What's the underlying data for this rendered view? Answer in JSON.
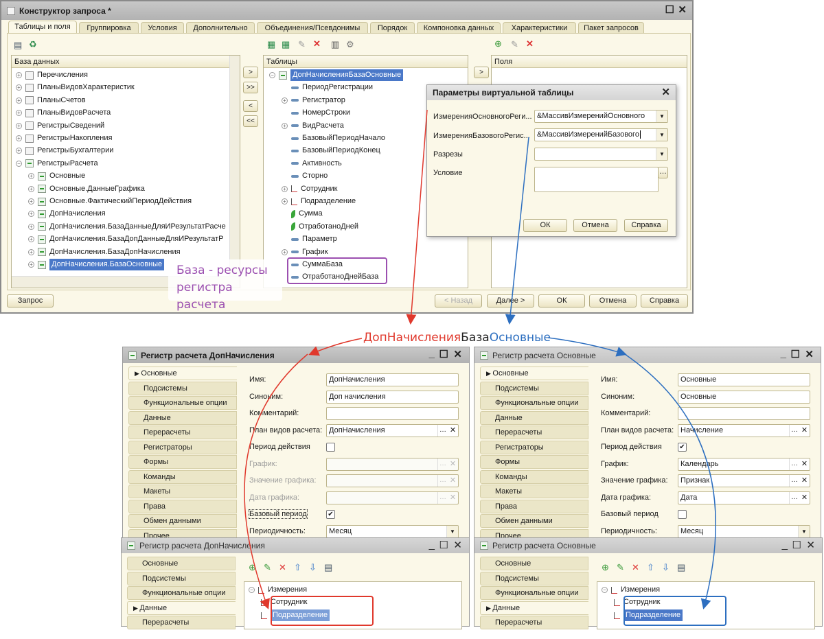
{
  "main_window": {
    "title": "Конструктор запроса *",
    "tabs": [
      "Таблицы и поля",
      "Группировка",
      "Условия",
      "Дополнительно",
      "Объединения/Псевдонимы",
      "Порядок",
      "Компоновка данных",
      "Характеристики",
      "Пакет запросов"
    ],
    "active_tab": "Таблицы и поля",
    "database_panel": {
      "header": "База данных",
      "items": [
        {
          "label": "Перечисления",
          "icon": "enum-icon",
          "level": 0,
          "exp": "+"
        },
        {
          "label": "ПланыВидовХарактеристик",
          "icon": "chart-of-characteristics-icon",
          "level": 0,
          "exp": "+"
        },
        {
          "label": "ПланыСчетов",
          "icon": "chart-of-accounts-icon",
          "level": 0,
          "exp": "+"
        },
        {
          "label": "ПланыВидовРасчета",
          "icon": "chart-of-calculation-types-icon",
          "level": 0,
          "exp": "+"
        },
        {
          "label": "РегистрыСведений",
          "icon": "information-register-icon",
          "level": 0,
          "exp": "+"
        },
        {
          "label": "РегистрыНакопления",
          "icon": "accumulation-register-icon",
          "level": 0,
          "exp": "+"
        },
        {
          "label": "РегистрыБухгалтерии",
          "icon": "accounting-register-icon",
          "level": 0,
          "exp": "+"
        },
        {
          "label": "РегистрыРасчета",
          "icon": "calculation-register-icon",
          "level": 0,
          "exp": "−"
        },
        {
          "label": "Основные",
          "icon": "calculation-register-icon",
          "level": 1,
          "exp": "+"
        },
        {
          "label": "Основные.ДанныеГрафика",
          "icon": "calculation-register-icon",
          "level": 1,
          "exp": "+"
        },
        {
          "label": "Основные.ФактическийПериодДействия",
          "icon": "calculation-register-icon",
          "level": 1,
          "exp": "+"
        },
        {
          "label": "ДопНачисления",
          "icon": "calculation-register-icon",
          "level": 1,
          "exp": "+"
        },
        {
          "label": "ДопНачисления.БазаДанныеДляИРезультатРасче",
          "icon": "calculation-register-icon",
          "level": 1,
          "exp": "+"
        },
        {
          "label": "ДопНачисления.БазаДопДанныеДляИРезультатР",
          "icon": "calculation-register-icon",
          "level": 1,
          "exp": "+"
        },
        {
          "label": "ДопНачисления.БазаДопНачисления",
          "icon": "calculation-register-icon",
          "level": 1,
          "exp": "+"
        },
        {
          "label": "ДопНачисления.БазаОсновные",
          "icon": "calculation-register-icon",
          "level": 1,
          "exp": "+",
          "selected": true
        }
      ]
    },
    "move_buttons": [
      ">",
      ">>",
      "<",
      "<<"
    ],
    "tables_panel": {
      "header": "Таблицы",
      "items": [
        {
          "label": "ДопНачисленияБазаОсновные",
          "icon": "calculation-register-icon",
          "level": 0,
          "exp": "−",
          "selected": true
        },
        {
          "label": "ПериодРегистрации",
          "icon": "attribute-icon",
          "level": 1,
          "exp": ""
        },
        {
          "label": "Регистратор",
          "icon": "attribute-icon",
          "level": 1,
          "exp": "+"
        },
        {
          "label": "НомерСтроки",
          "icon": "attribute-icon",
          "level": 1,
          "exp": ""
        },
        {
          "label": "ВидРасчета",
          "icon": "attribute-icon",
          "level": 1,
          "exp": "+"
        },
        {
          "label": "БазовыйПериодНачало",
          "icon": "attribute-icon",
          "level": 1,
          "exp": ""
        },
        {
          "label": "БазовыйПериодКонец",
          "icon": "attribute-icon",
          "level": 1,
          "exp": ""
        },
        {
          "label": "Активность",
          "icon": "attribute-icon",
          "level": 1,
          "exp": ""
        },
        {
          "label": "Сторно",
          "icon": "attribute-icon",
          "level": 1,
          "exp": ""
        },
        {
          "label": "Сотрудник",
          "icon": "dimension-icon",
          "level": 1,
          "exp": "+"
        },
        {
          "label": "Подразделение",
          "icon": "dimension-icon",
          "level": 1,
          "exp": "+"
        },
        {
          "label": "Сумма",
          "icon": "resource-icon",
          "level": 1,
          "exp": ""
        },
        {
          "label": "ОтработаноДней",
          "icon": "resource-icon",
          "level": 1,
          "exp": ""
        },
        {
          "label": "Параметр",
          "icon": "attribute-icon",
          "level": 1,
          "exp": ""
        },
        {
          "label": "График",
          "icon": "attribute-icon",
          "level": 1,
          "exp": "+"
        },
        {
          "label": "СуммаБаза",
          "icon": "attribute-icon",
          "level": 1,
          "exp": ""
        },
        {
          "label": "ОтработаноДнейБаза",
          "icon": "attribute-icon",
          "level": 1,
          "exp": ""
        }
      ]
    },
    "fields_panel": {
      "header": "Поля",
      "add_button": ">"
    },
    "buttons": {
      "query": "Запрос",
      "back": "< Назад",
      "next": "Далее >",
      "ok": "ОК",
      "cancel": "Отмена",
      "help": "Справка"
    }
  },
  "virtual_params_dialog": {
    "title": "Параметры виртуальной таблицы",
    "fields": [
      {
        "label": "ИзмеренияОсновногоРеги...",
        "value": "&МассивИзмеренийОсновного"
      },
      {
        "label": "ИзмеренияБазовогоРегис...",
        "value": "&МассивИзмеренийБазового"
      },
      {
        "label": "Разрезы",
        "value": ""
      },
      {
        "label": "Условие",
        "value": ""
      }
    ],
    "buttons": {
      "ok": "ОК",
      "cancel": "Отмена",
      "help": "Справка"
    }
  },
  "annotations": {
    "base_note_line1": "База - ресурсы",
    "base_note_line2": "регистра расчета",
    "center_part1": "ДопНачисления",
    "center_part2": "База",
    "center_part3": "Основные",
    "colors": {
      "red": "#e0382c",
      "blue": "#2d6fc0",
      "purple": "#9b4fb0"
    }
  },
  "register_windows": [
    {
      "title": "Регистр расчета ДопНачисления",
      "tabs": [
        "Основные",
        "Подсистемы",
        "Функциональные опции",
        "Данные",
        "Перерасчеты",
        "Регистраторы",
        "Формы",
        "Команды",
        "Макеты",
        "Права",
        "Обмен данными",
        "Прочее"
      ],
      "fields": [
        {
          "label": "Имя:",
          "kind": "text",
          "value": "ДопНачисления"
        },
        {
          "label": "Синоним:",
          "kind": "text",
          "value": "Доп начисления"
        },
        {
          "label": "Комментарий:",
          "kind": "text",
          "value": ""
        },
        {
          "label": "План видов расчета:",
          "kind": "ref",
          "value": "ДопНачисления"
        },
        {
          "label": "Период действия",
          "kind": "check",
          "checked": false
        },
        {
          "label": "График:",
          "kind": "ref",
          "value": "",
          "disabled": true
        },
        {
          "label": "Значение графика:",
          "kind": "ref",
          "value": "",
          "disabled": true
        },
        {
          "label": "Дата графика:",
          "kind": "ref",
          "value": "",
          "disabled": true
        },
        {
          "label": "Базовый период",
          "kind": "check",
          "checked": true,
          "focused": true
        },
        {
          "label": "Периодичность:",
          "kind": "select",
          "value": "Месяц"
        }
      ]
    },
    {
      "title": "Регистр расчета Основные",
      "tabs": [
        "Основные",
        "Подсистемы",
        "Функциональные опции",
        "Данные",
        "Перерасчеты",
        "Регистраторы",
        "Формы",
        "Команды",
        "Макеты",
        "Права",
        "Обмен данными",
        "Прочее"
      ],
      "fields": [
        {
          "label": "Имя:",
          "kind": "text",
          "value": "Основные"
        },
        {
          "label": "Синоним:",
          "kind": "text",
          "value": "Основные"
        },
        {
          "label": "Комментарий:",
          "kind": "text",
          "value": ""
        },
        {
          "label": "План видов расчета:",
          "kind": "ref",
          "value": "Начисление"
        },
        {
          "label": "Период действия",
          "kind": "check",
          "checked": true
        },
        {
          "label": "График:",
          "kind": "ref",
          "value": "Календарь"
        },
        {
          "label": "Значение графика:",
          "kind": "ref",
          "value": "Признак"
        },
        {
          "label": "Дата графика:",
          "kind": "ref",
          "value": "Дата"
        },
        {
          "label": "Базовый период",
          "kind": "check",
          "checked": false
        },
        {
          "label": "Периодичность:",
          "kind": "select",
          "value": "Месяц"
        }
      ]
    }
  ],
  "data_windows": [
    {
      "title": "Регистр расчета ДопНачисления",
      "tabs": [
        "Основные",
        "Подсистемы",
        "Функциональные опции",
        "Данные",
        "Перерасчеты"
      ],
      "active_tab": "Данные",
      "group": "Измерения",
      "items": [
        "Сотрудник",
        "Подразделение"
      ],
      "selected": "Подразделение"
    },
    {
      "title": "Регистр расчета Основные",
      "tabs": [
        "Основные",
        "Подсистемы",
        "Функциональные опции",
        "Данные",
        "Перерасчеты"
      ],
      "active_tab": "Данные",
      "group": "Измерения",
      "items": [
        "Сотрудник",
        "Подразделение"
      ],
      "selected": "Подразделение"
    }
  ]
}
